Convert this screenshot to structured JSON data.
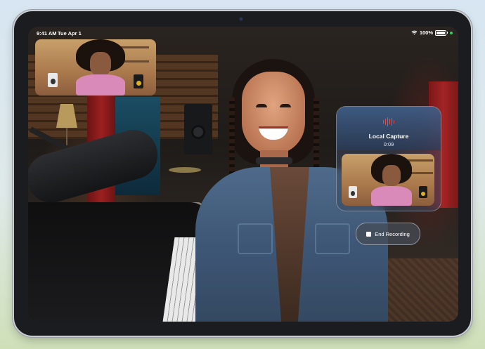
{
  "status_bar": {
    "time": "9:41 AM",
    "date": "Tue Apr 1",
    "battery": "100%",
    "wifi_icon": "wifi-icon",
    "battery_icon": "battery-full-icon",
    "mic_indicator_color": "#2fd158"
  },
  "video": {
    "scene": "studio",
    "pip_feed": "remote-participant"
  },
  "local_capture": {
    "title": "Local Capture",
    "timer": "0:09",
    "icon": "waveform-icon",
    "accent_color": "#ff453a"
  },
  "end_recording": {
    "label": "End Recording",
    "icon": "stop-icon"
  }
}
